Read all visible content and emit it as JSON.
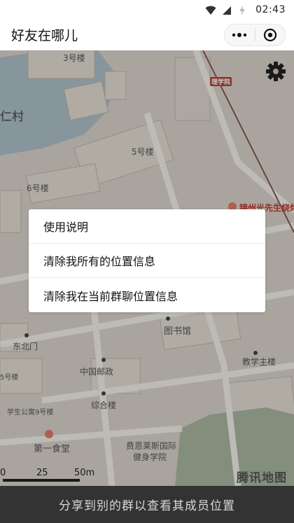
{
  "status_bar": {
    "time": "02:43"
  },
  "header": {
    "title": "好友在哪儿"
  },
  "map": {
    "labels": {
      "village": "仁村",
      "b3": "3号楼",
      "b5": "5号楼",
      "b6": "6号楼",
      "road_tag": "理学院",
      "poi_red": "锦州光先生烧烤",
      "library": "图书馆",
      "east_gate": "东北门",
      "b5b": "5号楼",
      "post": "中国邮政",
      "teach": "教学主楼",
      "comp": "综合楼",
      "apt": "学生公寓9号楼",
      "canteen": "第一食堂",
      "clinic_1": "费恩莱斯国际",
      "clinic_2": "健身学院"
    },
    "scale": {
      "l0": "0",
      "l1": "25",
      "l2": "50m"
    },
    "brand": "腾讯地图"
  },
  "menu": {
    "items": [
      {
        "label": "使用说明"
      },
      {
        "label": "清除我所有的位置信息"
      },
      {
        "label": "清除我在当前群聊位置信息"
      }
    ]
  },
  "bottom": {
    "share_label": "分享到别的群以查看其成员位置"
  }
}
